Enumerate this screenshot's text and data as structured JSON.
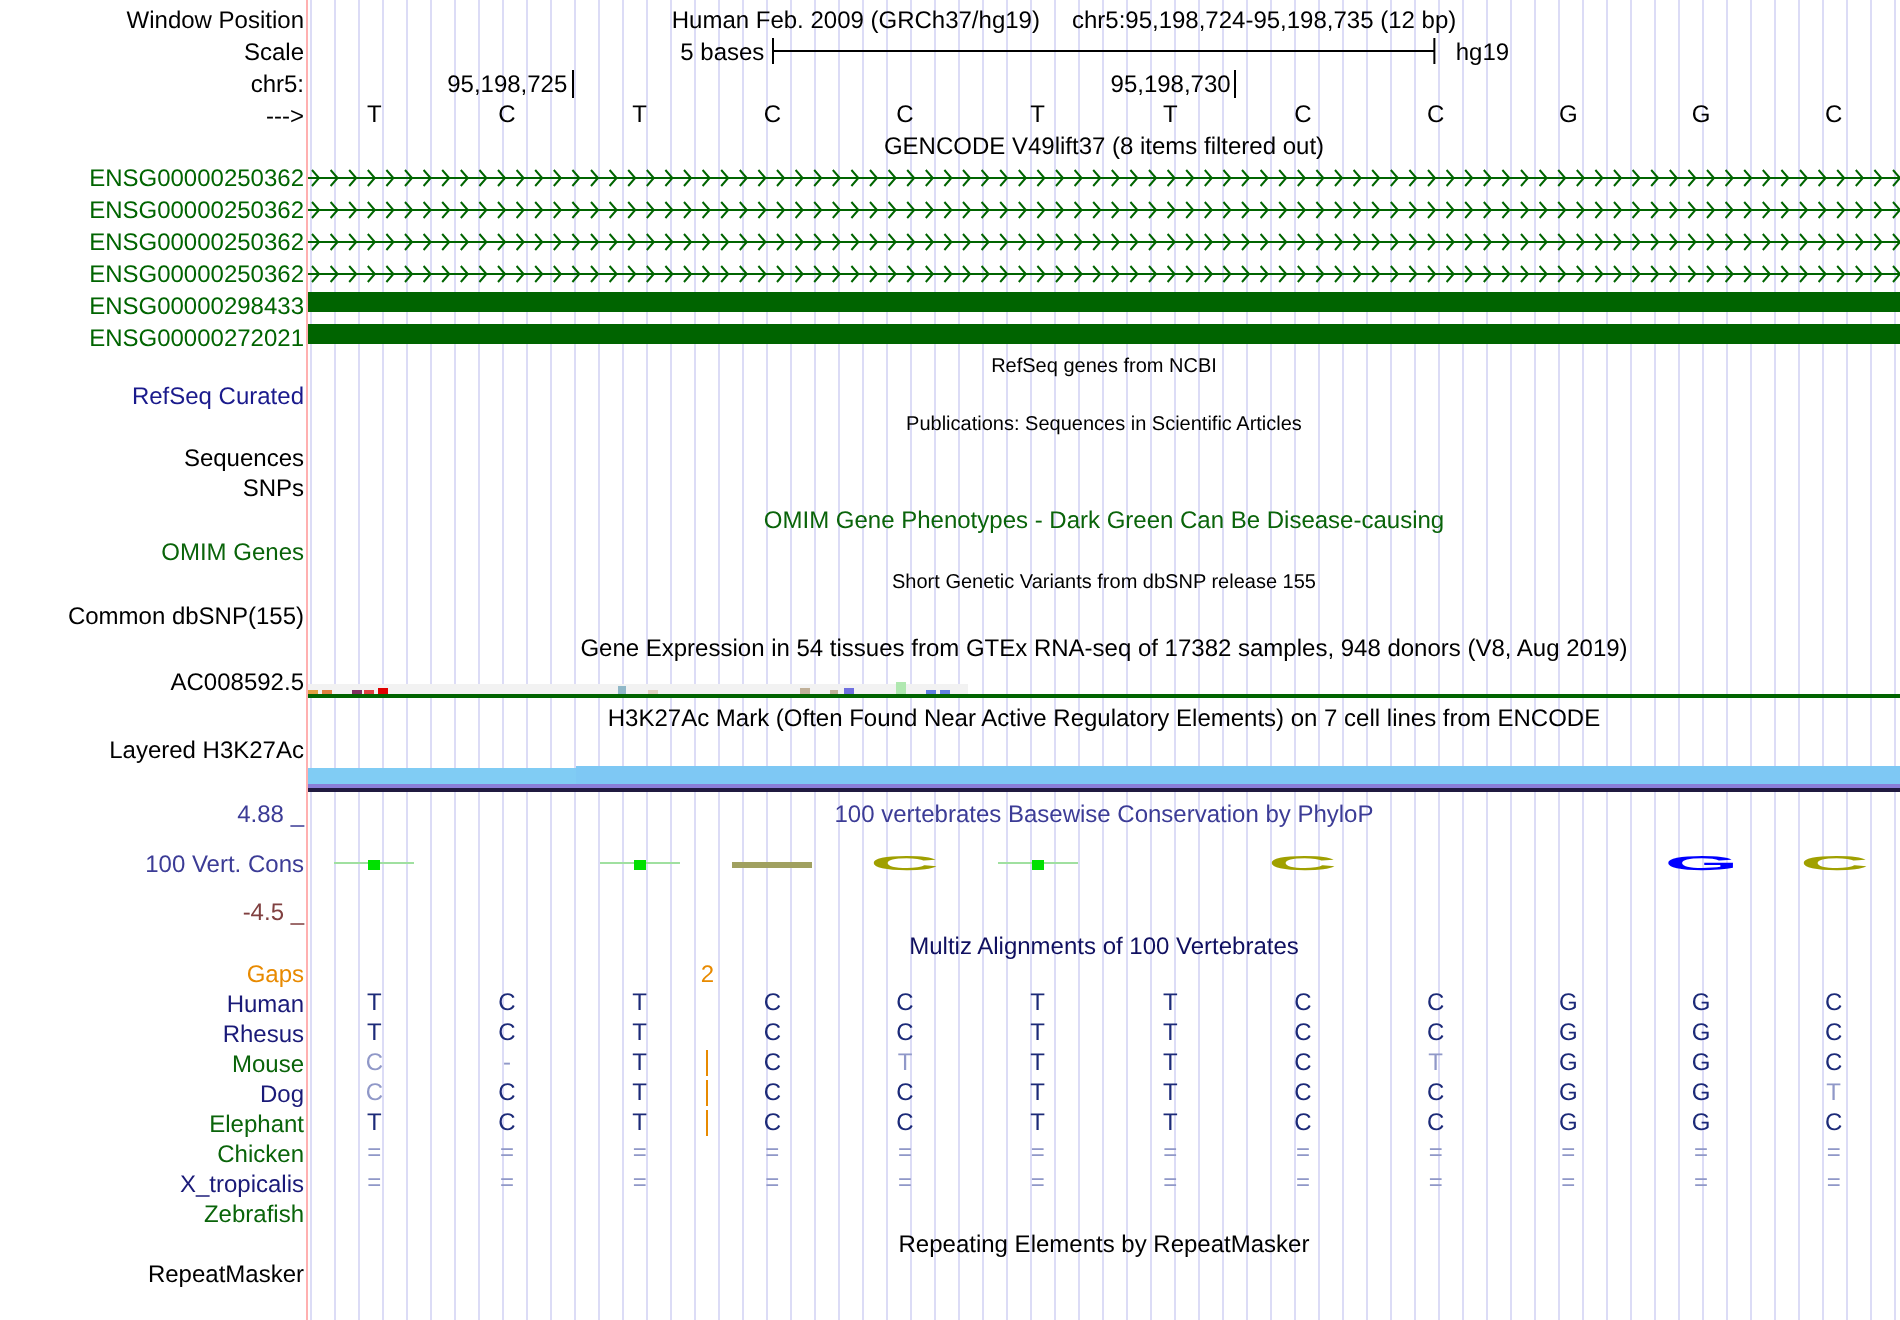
{
  "header": {
    "window_position_label": "Window Position",
    "assembly": "Human Feb. 2009 (GRCh37/hg19)",
    "position": "chr5:95,198,724-95,198,735 (12 bp)",
    "scale_label": "Scale",
    "scale_text": "5 bases",
    "scale_assembly": "hg19",
    "chrom_label": "chr5:",
    "strand_label": "--->",
    "bases": [
      {
        "base": "T"
      },
      {
        "base": "C",
        "coordinate": "95,198,725"
      },
      {
        "base": "T"
      },
      {
        "base": "C"
      },
      {
        "base": "C"
      },
      {
        "base": "T"
      },
      {
        "base": "T",
        "coordinate": "95,198,730"
      },
      {
        "base": "C"
      },
      {
        "base": "C"
      },
      {
        "base": "G"
      },
      {
        "base": "G"
      },
      {
        "base": "C"
      }
    ]
  },
  "gencode": {
    "title": "GENCODE V49lift37 (8 items filtered out)",
    "items": [
      {
        "name": "ENSG00000250362",
        "kind": "intron"
      },
      {
        "name": "ENSG00000250362",
        "kind": "intron"
      },
      {
        "name": "ENSG00000250362",
        "kind": "intron"
      },
      {
        "name": "ENSG00000250362",
        "kind": "intron"
      },
      {
        "name": "ENSG00000298433",
        "kind": "exon"
      },
      {
        "name": "ENSG00000272021",
        "kind": "exon"
      }
    ]
  },
  "refseq": {
    "title": "RefSeq genes from NCBI",
    "label": "RefSeq Curated"
  },
  "publications": {
    "title": "Publications: Sequences in Scientific Articles",
    "labels": [
      "Sequences",
      "SNPs"
    ]
  },
  "omim": {
    "title": "OMIM Gene Phenotypes - Dark Green Can Be Disease-causing",
    "label": "OMIM Genes"
  },
  "dbsnp": {
    "title": "Short Genetic Variants from dbSNP release 155",
    "label": "Common dbSNP(155)"
  },
  "gtex": {
    "title": "Gene Expression in 54 tissues from GTEx RNA-seq of 17382 samples, 948 donors (V8, Aug 2019)",
    "label": "AC008592.5"
  },
  "h3k27ac": {
    "title": "H3K27Ac Mark (Often Found Near Active Regulatory Elements) on 7 cell lines from ENCODE",
    "label": "Layered H3K27Ac"
  },
  "phylop": {
    "title": "100 vertebrates Basewise Conservation by PhyloP",
    "label": "100 Vert. Cons",
    "max": "4.88 _",
    "min": "-4.5 _",
    "columns": [
      {
        "kind": "bar"
      },
      {
        "kind": "none"
      },
      {
        "kind": "bar"
      },
      {
        "kind": "line"
      },
      {
        "kind": "letter",
        "letter": "C",
        "color": "#a0a000"
      },
      {
        "kind": "bar"
      },
      {
        "kind": "none"
      },
      {
        "kind": "letter",
        "letter": "C",
        "color": "#a0a000"
      },
      {
        "kind": "none"
      },
      {
        "kind": "none"
      },
      {
        "kind": "letter",
        "letter": "G",
        "color": "#0000ff"
      },
      {
        "kind": "letter",
        "letter": "C",
        "color": "#a0a000"
      }
    ]
  },
  "multiz": {
    "title": "Multiz Alignments of 100 Vertebrates",
    "gaps_label": "Gaps",
    "gap_count": "2",
    "species": [
      {
        "name": "Human",
        "color": "#1a1a78",
        "bases": [
          {
            "base": "T",
            "mismatch": false,
            "insertion": false
          },
          {
            "base": "C",
            "mismatch": false,
            "insertion": false
          },
          {
            "base": "T",
            "mismatch": false,
            "insertion": false
          },
          {
            "base": "C",
            "mismatch": false,
            "insertion": false
          },
          {
            "base": "C",
            "mismatch": false,
            "insertion": false
          },
          {
            "base": "T",
            "mismatch": false,
            "insertion": false
          },
          {
            "base": "T",
            "mismatch": false,
            "insertion": false
          },
          {
            "base": "C",
            "mismatch": false,
            "insertion": false
          },
          {
            "base": "C",
            "mismatch": false,
            "insertion": false
          },
          {
            "base": "G",
            "mismatch": false,
            "insertion": false
          },
          {
            "base": "G",
            "mismatch": false,
            "insertion": false
          },
          {
            "base": "C",
            "mismatch": false,
            "insertion": false
          }
        ]
      },
      {
        "name": "Rhesus",
        "color": "#1a1a78",
        "bases": [
          {
            "base": "T",
            "mismatch": false,
            "insertion": false
          },
          {
            "base": "C",
            "mismatch": false,
            "insertion": false
          },
          {
            "base": "T",
            "mismatch": false,
            "insertion": false
          },
          {
            "base": "C",
            "mismatch": false,
            "insertion": false
          },
          {
            "base": "C",
            "mismatch": false,
            "insertion": false
          },
          {
            "base": "T",
            "mismatch": false,
            "insertion": false
          },
          {
            "base": "T",
            "mismatch": false,
            "insertion": false
          },
          {
            "base": "C",
            "mismatch": false,
            "insertion": false
          },
          {
            "base": "C",
            "mismatch": false,
            "insertion": false
          },
          {
            "base": "G",
            "mismatch": false,
            "insertion": false
          },
          {
            "base": "G",
            "mismatch": false,
            "insertion": false
          },
          {
            "base": "C",
            "mismatch": false,
            "insertion": false
          }
        ]
      },
      {
        "name": "Mouse",
        "color": "#0a640a",
        "bases": [
          {
            "base": "C",
            "mismatch": true,
            "insertion": false
          },
          {
            "base": "-",
            "mismatch": true,
            "insertion": false
          },
          {
            "base": "T",
            "mismatch": false,
            "insertion": true
          },
          {
            "base": "C",
            "mismatch": false,
            "insertion": false
          },
          {
            "base": "T",
            "mismatch": true,
            "insertion": false
          },
          {
            "base": "T",
            "mismatch": false,
            "insertion": false
          },
          {
            "base": "T",
            "mismatch": false,
            "insertion": false
          },
          {
            "base": "C",
            "mismatch": false,
            "insertion": false
          },
          {
            "base": "T",
            "mismatch": true,
            "insertion": false
          },
          {
            "base": "G",
            "mismatch": false,
            "insertion": false
          },
          {
            "base": "G",
            "mismatch": false,
            "insertion": false
          },
          {
            "base": "C",
            "mismatch": false,
            "insertion": false
          }
        ]
      },
      {
        "name": "Dog",
        "color": "#1a1a78",
        "bases": [
          {
            "base": "C",
            "mismatch": true,
            "insertion": false
          },
          {
            "base": "C",
            "mismatch": false,
            "insertion": false
          },
          {
            "base": "T",
            "mismatch": false,
            "insertion": true
          },
          {
            "base": "C",
            "mismatch": false,
            "insertion": false
          },
          {
            "base": "C",
            "mismatch": false,
            "insertion": false
          },
          {
            "base": "T",
            "mismatch": false,
            "insertion": false
          },
          {
            "base": "T",
            "mismatch": false,
            "insertion": false
          },
          {
            "base": "C",
            "mismatch": false,
            "insertion": false
          },
          {
            "base": "C",
            "mismatch": false,
            "insertion": false
          },
          {
            "base": "G",
            "mismatch": false,
            "insertion": false
          },
          {
            "base": "G",
            "mismatch": false,
            "insertion": false
          },
          {
            "base": "T",
            "mismatch": true,
            "insertion": false
          }
        ]
      },
      {
        "name": "Elephant",
        "color": "#0a640a",
        "bases": [
          {
            "base": "T",
            "mismatch": false,
            "insertion": false
          },
          {
            "base": "C",
            "mismatch": false,
            "insertion": false
          },
          {
            "base": "T",
            "mismatch": false,
            "insertion": true
          },
          {
            "base": "C",
            "mismatch": false,
            "insertion": false
          },
          {
            "base": "C",
            "mismatch": false,
            "insertion": false
          },
          {
            "base": "T",
            "mismatch": false,
            "insertion": false
          },
          {
            "base": "T",
            "mismatch": false,
            "insertion": false
          },
          {
            "base": "C",
            "mismatch": false,
            "insertion": false
          },
          {
            "base": "C",
            "mismatch": false,
            "insertion": false
          },
          {
            "base": "G",
            "mismatch": false,
            "insertion": false
          },
          {
            "base": "G",
            "mismatch": false,
            "insertion": false
          },
          {
            "base": "C",
            "mismatch": false,
            "insertion": false
          }
        ]
      },
      {
        "name": "Chicken",
        "color": "#0a640a",
        "bases": [
          {
            "base": "=",
            "mismatch": true,
            "insertion": false
          },
          {
            "base": "=",
            "mismatch": true,
            "insertion": false
          },
          {
            "base": "=",
            "mismatch": true,
            "insertion": false
          },
          {
            "base": "=",
            "mismatch": true,
            "insertion": false
          },
          {
            "base": "=",
            "mismatch": true,
            "insertion": false
          },
          {
            "base": "=",
            "mismatch": true,
            "insertion": false
          },
          {
            "base": "=",
            "mismatch": true,
            "insertion": false
          },
          {
            "base": "=",
            "mismatch": true,
            "insertion": false
          },
          {
            "base": "=",
            "mismatch": true,
            "insertion": false
          },
          {
            "base": "=",
            "mismatch": true,
            "insertion": false
          },
          {
            "base": "=",
            "mismatch": true,
            "insertion": false
          },
          {
            "base": "=",
            "mismatch": true,
            "insertion": false
          }
        ]
      },
      {
        "name": "X_tropicalis",
        "color": "#1a1a78",
        "bases": [
          {
            "base": "=",
            "mismatch": true,
            "insertion": false
          },
          {
            "base": "=",
            "mismatch": true,
            "insertion": false
          },
          {
            "base": "=",
            "mismatch": true,
            "insertion": false
          },
          {
            "base": "=",
            "mismatch": true,
            "insertion": false
          },
          {
            "base": "=",
            "mismatch": true,
            "insertion": false
          },
          {
            "base": "=",
            "mismatch": true,
            "insertion": false
          },
          {
            "base": "=",
            "mismatch": true,
            "insertion": false
          },
          {
            "base": "=",
            "mismatch": true,
            "insertion": false
          },
          {
            "base": "=",
            "mismatch": true,
            "insertion": false
          },
          {
            "base": "=",
            "mismatch": true,
            "insertion": false
          },
          {
            "base": "=",
            "mismatch": true,
            "insertion": false
          },
          {
            "base": "=",
            "mismatch": true,
            "insertion": false
          }
        ]
      },
      {
        "name": "Zebrafish",
        "color": "#0a640a"
      }
    ]
  },
  "repeatmasker": {
    "title": "Repeating Elements by RepeatMasker",
    "label": "RepeatMasker"
  }
}
